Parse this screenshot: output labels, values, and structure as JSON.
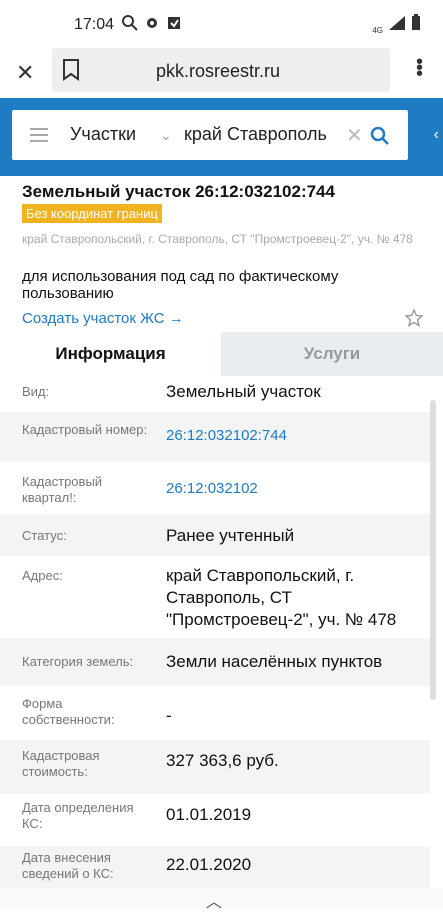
{
  "status_bar": {
    "time": "17:04",
    "network": "4G"
  },
  "browser": {
    "url": "pkk.rosreestr.ru"
  },
  "search": {
    "category": "Участки",
    "value": "край Ставрополь"
  },
  "parcel": {
    "title": "Земельный участок 26:12:032102:744",
    "badge": "Без координат границ",
    "address_gray": "край Ставропольский, г. Ставрополь, СТ \"Промстроевец-2\", уч. № 478",
    "usage": "для использования под сад по фактическому пользованию",
    "create_link": "Создать участок ЖС →"
  },
  "tabs": {
    "info": "Информация",
    "services": "Услуги"
  },
  "rows": [
    {
      "label": "Вид:",
      "value": "Земельный участок"
    },
    {
      "label": "Кадастровый номер:",
      "value": "26:12:032102:744"
    },
    {
      "label": "Кадастровый квартал!:",
      "value": "26:12:032102"
    },
    {
      "label": "Статус:",
      "value": "Ранее учтенный"
    },
    {
      "label": "Адрес:",
      "value": "край Ставропольский, г. Ставрополь, СТ \"Промстроевец-2\", уч. № 478"
    },
    {
      "label": "Категория земель:",
      "value": "Земли населённых пунктов"
    },
    {
      "label": "Форма собственности:",
      "value": "-"
    },
    {
      "label": "Кадастровая стоимость:",
      "value": "327 363,6 руб."
    },
    {
      "label": "Дата определения КС:",
      "value": "01.01.2019"
    },
    {
      "label": "Дата внесения сведений о КС:",
      "value": "22.01.2020"
    }
  ],
  "colors": {
    "accent": "#1e7bc4",
    "badge": "#f2b321",
    "alt_row": "#f2f4f6"
  }
}
